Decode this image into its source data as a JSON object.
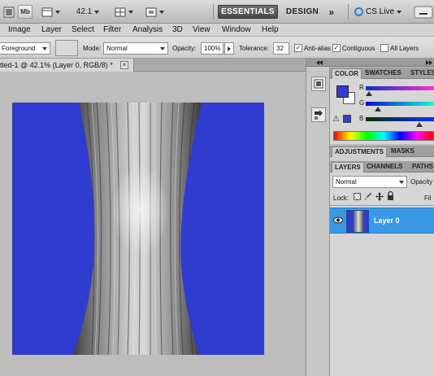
{
  "appbar": {
    "mb_label": "Mb",
    "zoom": "42.1",
    "workspace_active": "ESSENTIALS",
    "workspace_other": "DESIGN",
    "more": "»",
    "cslive": "CS Live"
  },
  "menu": {
    "items": [
      "Image",
      "Layer",
      "Select",
      "Filter",
      "Analysis",
      "3D",
      "View",
      "Window",
      "Help"
    ]
  },
  "options": {
    "fill_source": "Foreground",
    "mode_label": "Mode:",
    "mode_value": "Normal",
    "opacity_label": "Opacity:",
    "opacity_value": "100%",
    "tolerance_label": "Tolerance:",
    "tolerance_value": "32",
    "antialias_label": "Anti-alias",
    "antialias_checked": true,
    "contiguous_label": "Contiguous",
    "contiguous_checked": true,
    "alllayers_label": "All Layers",
    "alllayers_checked": false
  },
  "document": {
    "tab_title": "tled-1 @ 42.1% (Layer 0, RGB/8) *",
    "close_glyph": "×",
    "image_background": "#2f3ccf"
  },
  "color_panel": {
    "tabs": [
      "COLOR",
      "SWATCHES",
      "STYLES"
    ],
    "channels": [
      {
        "name": "R",
        "value": 0.05
      },
      {
        "name": "G",
        "value": 0.18
      },
      {
        "name": "B",
        "value": 0.78
      }
    ],
    "foreground": "#2f3ccf",
    "background": "#ffffff",
    "warning_glyph": "⚠"
  },
  "adjustments_panel": {
    "tabs": [
      "ADJUSTMENTS",
      "MASKS"
    ]
  },
  "layers_panel": {
    "tabs": [
      "LAYERS",
      "CHANNELS",
      "PATHS"
    ],
    "blend_mode": "Normal",
    "opacity_label": "Opacity",
    "lock_label": "Lock:",
    "fill_label": "Fil",
    "layers": [
      {
        "name": "Layer 0",
        "visible": true,
        "selected": true
      }
    ]
  },
  "colors": {
    "selection_blue": "#3a99e6",
    "image_blue": "#2f3ccf",
    "cslive_blue": "#2b7bd6"
  }
}
